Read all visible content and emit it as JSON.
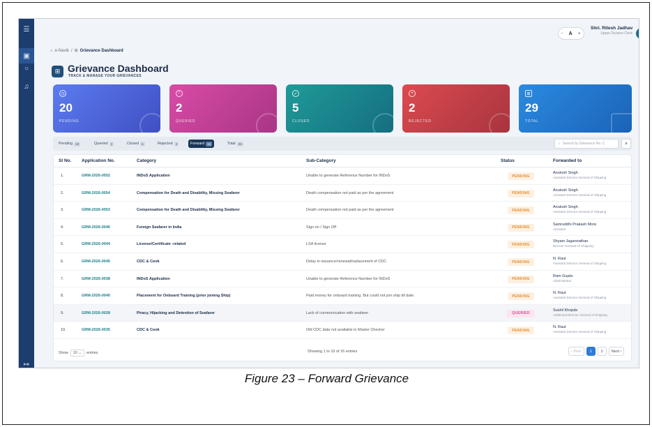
{
  "topbar": {
    "zoom": {
      "minus": "-",
      "label": "A",
      "plus": "+"
    },
    "user_name": "Shri. Ritesh Jadhav",
    "user_role": "Upper Division Clerk",
    "user_initials": "RR"
  },
  "breadcrumb": {
    "root": "e-Navik",
    "sep": "/",
    "current": "Grievance Dashboard"
  },
  "page": {
    "title": "Grievance Dashboard",
    "subtitle": "TRACK & MANAGE YOUR GRIEVANCES"
  },
  "cards": [
    {
      "count": "20",
      "label": "PENDING",
      "icon": "clock-icon"
    },
    {
      "count": "2",
      "label": "QUERIED",
      "icon": "alert-icon"
    },
    {
      "count": "5",
      "label": "CLOSED",
      "icon": "check-circle-icon"
    },
    {
      "count": "2",
      "label": "REJECTED",
      "icon": "x-circle-icon"
    },
    {
      "count": "29",
      "label": "TOTAL",
      "icon": "grid-icon"
    }
  ],
  "tabs": [
    {
      "label": "Pending",
      "count": "20"
    },
    {
      "label": "Queried",
      "count": "3"
    },
    {
      "label": "Closed",
      "count": "5"
    },
    {
      "label": "Rejected",
      "count": "2"
    },
    {
      "label": "Forward",
      "count": "16"
    },
    {
      "label": "Total",
      "count": "29"
    }
  ],
  "search": {
    "placeholder": "Search by Grievance No. C"
  },
  "table": {
    "headers": [
      "Sl No.",
      "Application No.",
      "Category",
      "Sub-Category",
      "Status",
      "Forwarded to"
    ],
    "rows": [
      {
        "sl": "1.",
        "app": "GRM-2026-0052",
        "cat": "INDoS Application",
        "sub": "Unable to generate Reference Number for INDoS",
        "status": "PENDING",
        "fw_name": "Anutosh Singh",
        "fw_desig": "Assistant Director General of Shipping"
      },
      {
        "sl": "2.",
        "app": "GRM-2026-0054",
        "cat": "Compensation for Death and Disability, Missing Seafarer",
        "sub": "Death compensation not paid as per the agreement",
        "status": "PENDING",
        "fw_name": "Anutosh Singh",
        "fw_desig": "Assistant Director General of Shipping"
      },
      {
        "sl": "3.",
        "app": "GRM-2026-0053",
        "cat": "Compensation for Death and Disability, Missing Seafarer",
        "sub": "Death compensation not paid as per the agreement",
        "status": "PENDING",
        "fw_name": "Anutosh Singh",
        "fw_desig": "Assistant Director General of Shipping"
      },
      {
        "sl": "4.",
        "app": "GRM-2026-0046",
        "cat": "Foreign Seafarer in India",
        "sub": "Sign on / Sign Off",
        "status": "PENDING",
        "fw_name": "Samruddhi Prakash More",
        "fw_desig": "Assistant"
      },
      {
        "sl": "5.",
        "app": "GRM-2026-0044",
        "cat": "License/Certificate -related",
        "sub": "LSA license",
        "status": "PENDING",
        "fw_name": "Shyam Jagannathan",
        "fw_desig": "Director General Of Shipping"
      },
      {
        "sl": "6.",
        "app": "GRM-2026-0045",
        "cat": "CDC & Cook",
        "sub": "Delay in issuance/renewal/replacement of CDC",
        "status": "PENDING",
        "fw_name": "N. Raut",
        "fw_desig": "Assistant Director General of Shipping"
      },
      {
        "sl": "7.",
        "app": "GRM-2026-0038",
        "cat": "INDoS Application",
        "sub": "Unable to generate Reference Number for INDoS",
        "status": "PENDING",
        "fw_name": "Ram Gupta",
        "fw_desig": "Administrator"
      },
      {
        "sl": "8.",
        "app": "GRM-2026-0040",
        "cat": "Placement for Onboard Training (prior joining Ship)",
        "sub": "Paid money for onboard training. But could not join ship till date.",
        "status": "PENDING",
        "fw_name": "N. Raut",
        "fw_desig": "Assistant Director General of Shipping"
      },
      {
        "sl": "9.",
        "app": "GRM-2026-0028",
        "cat": "Piracy, Hijacking and Detention of Seafarer",
        "sub": "Lack of communication with seafarer",
        "status": "QUERIED",
        "fw_name": "Sushil Khopde",
        "fw_desig": "Additional Director General of Shipping"
      },
      {
        "sl": "10.",
        "app": "GRM-2026-0035",
        "cat": "CDC & Cook",
        "sub": "Old CDC data not available in Master Checker",
        "status": "PENDING",
        "fw_name": "N. Raut",
        "fw_desig": "Assistant Director General of Shipping"
      }
    ]
  },
  "footer": {
    "show_label": "Show",
    "show_value": "10",
    "show_suffix": "entries",
    "info": "Showing 1 to 10 of 16 entries",
    "prev": "Prev",
    "pages": [
      "1",
      "2"
    ],
    "next": "Next"
  },
  "caption": "Figure 23 – Forward Grievance",
  "colors": {
    "sidebar": "#1c3d6e",
    "card_pending": "#4f6ee0",
    "card_queried": "#c2409a",
    "card_closed": "#1a8a8f",
    "card_rejected": "#c8414a",
    "card_total": "#1f74c7",
    "accent": "#1b3656"
  }
}
